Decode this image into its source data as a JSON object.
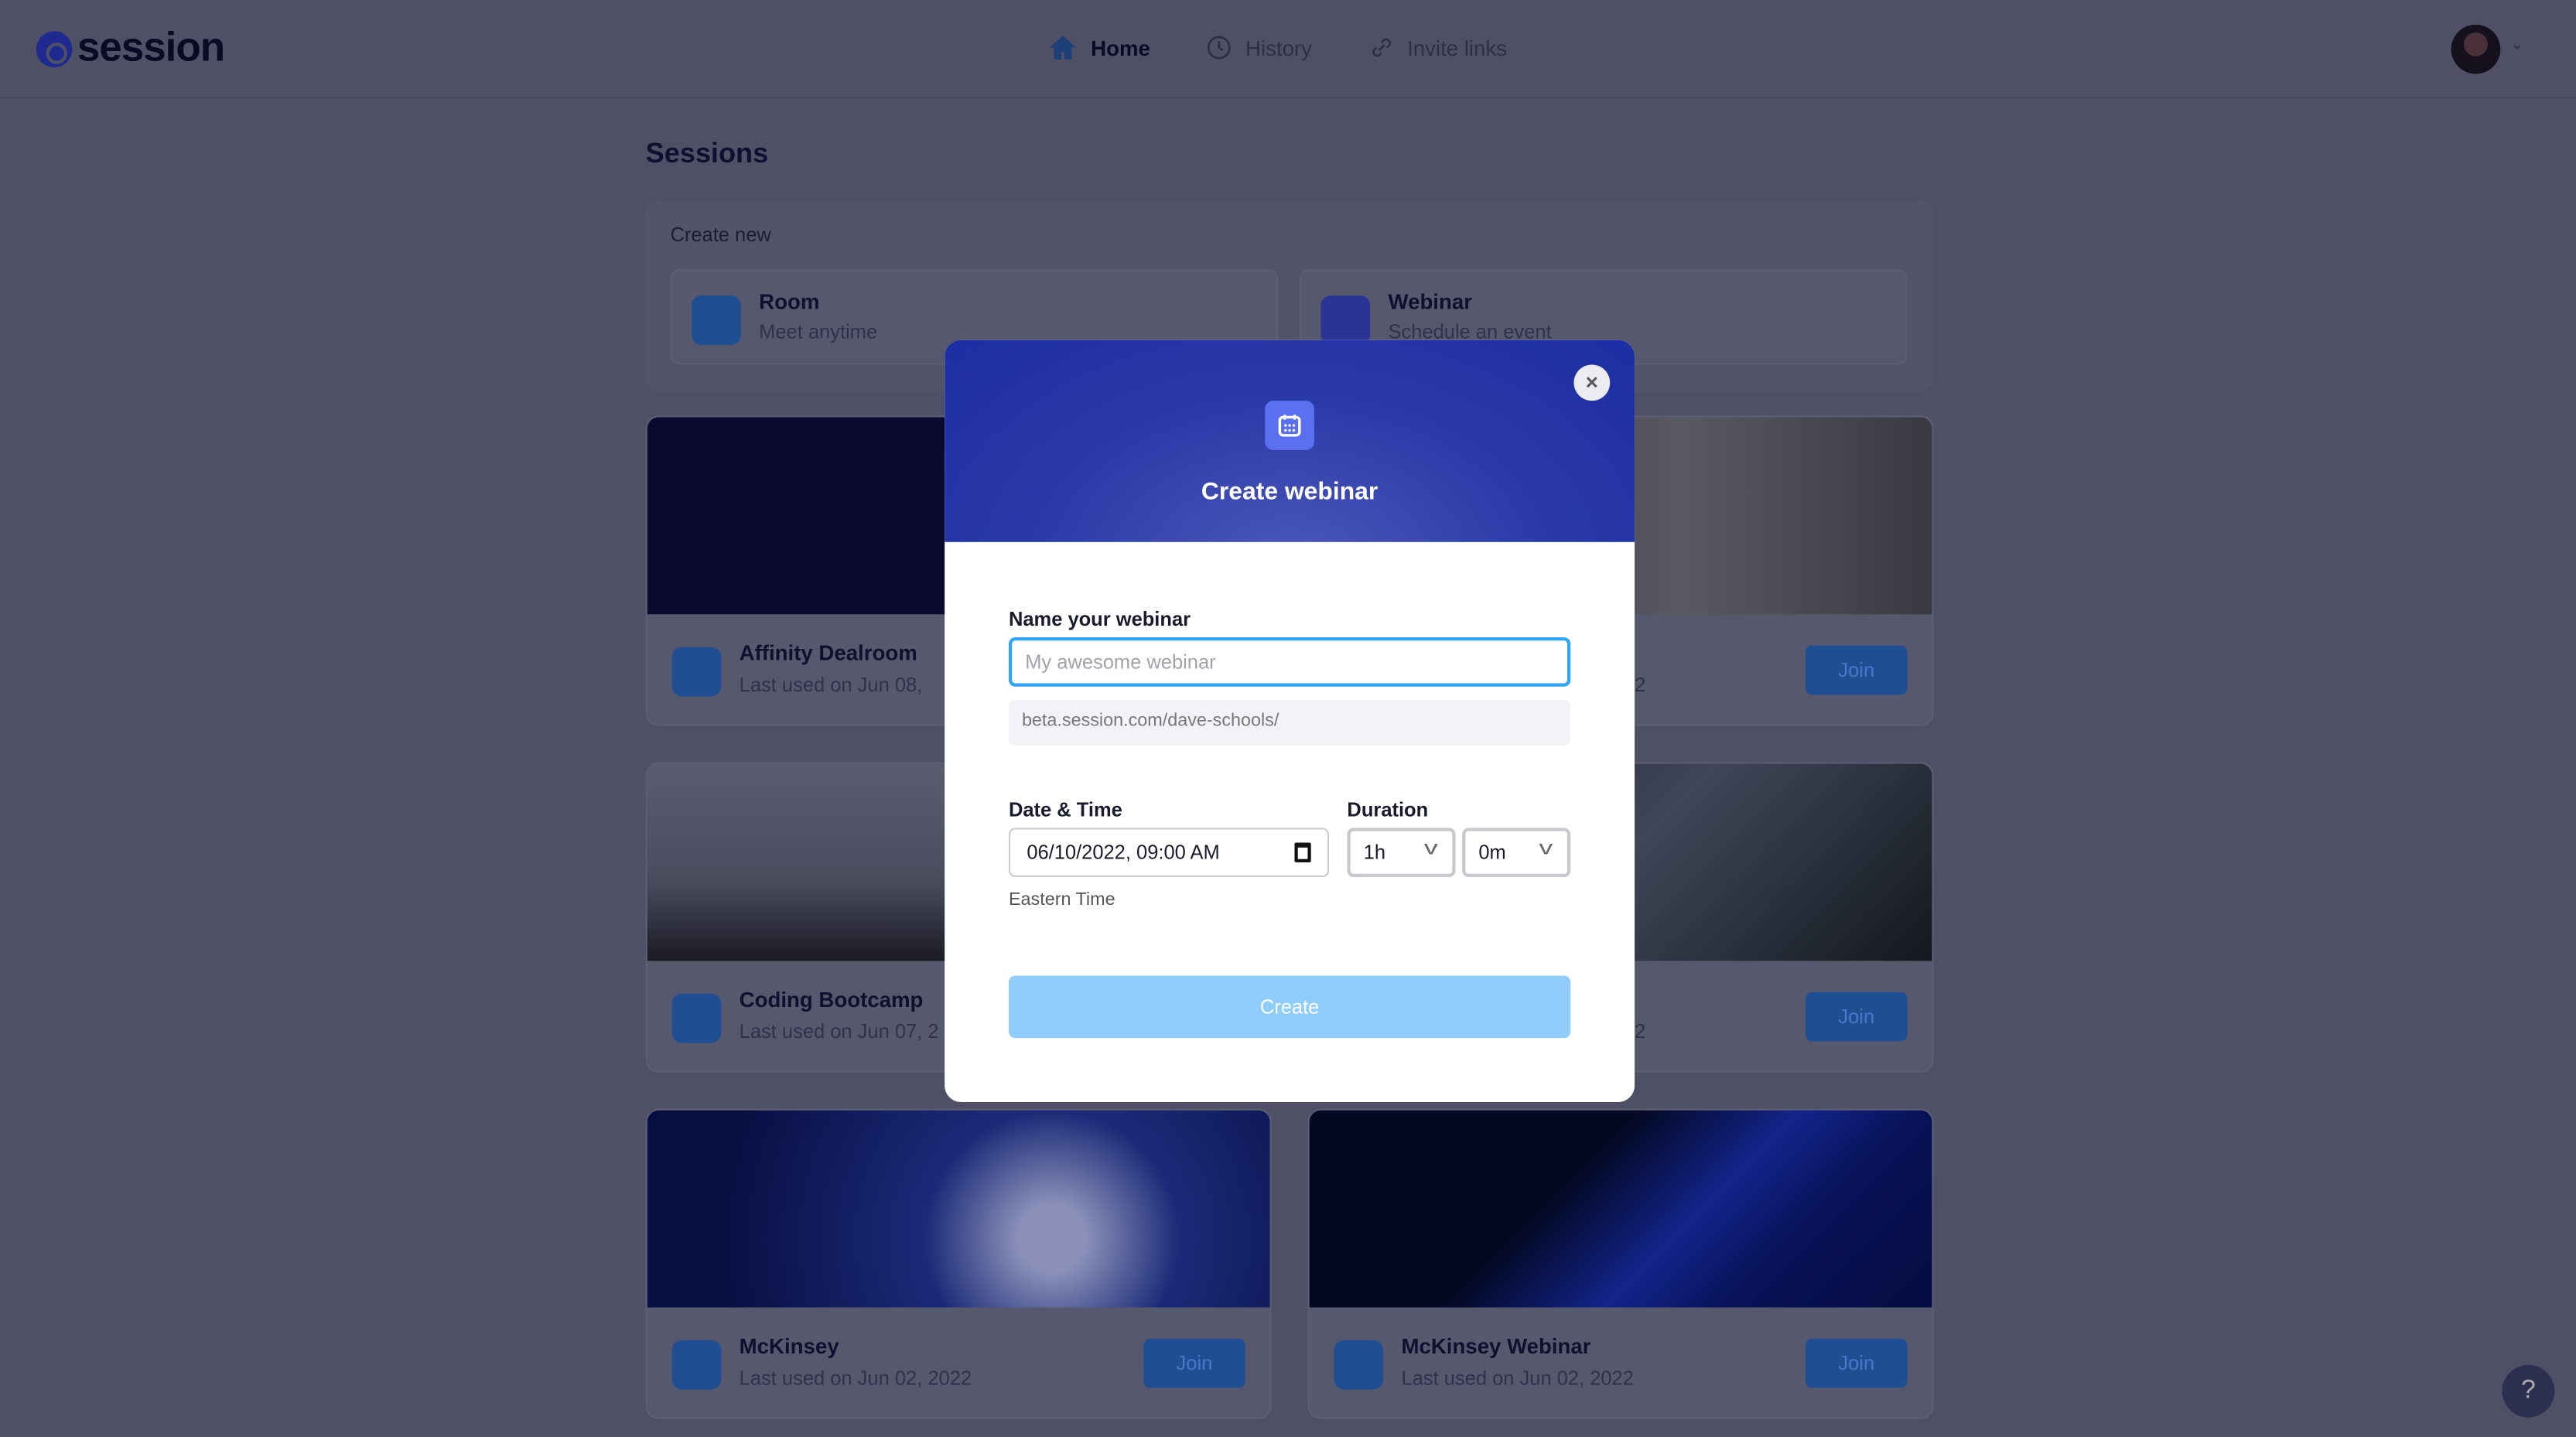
{
  "app": {
    "logo": "session"
  },
  "nav": [
    {
      "label": "Home",
      "icon": "home-icon"
    },
    {
      "label": "History",
      "icon": "clock-icon"
    },
    {
      "label": "Invite links",
      "icon": "link-icon"
    }
  ],
  "page": {
    "title": "Sessions",
    "create_new": "Create new",
    "create_options": [
      {
        "title": "Room",
        "subtitle": "Meet anytime"
      },
      {
        "title": "Webinar",
        "subtitle": "Schedule an event"
      }
    ],
    "sessions": [
      {
        "name": "Affinity Dealroom",
        "last_used": "Last used on Jun 08,"
      },
      {
        "name": "",
        "last_used": "2",
        "join": "Join"
      },
      {
        "name": "Coding Bootcamp",
        "last_used": "Last used on Jun 07, 2"
      },
      {
        "name": "",
        "last_used": "2",
        "join": "Join"
      },
      {
        "name": "McKinsey",
        "last_used": "Last used on Jun 02, 2022",
        "join": "Join"
      },
      {
        "name": "McKinsey Webinar",
        "last_used": "Last used on Jun 02, 2022",
        "join": "Join"
      }
    ]
  },
  "help": "?",
  "modal": {
    "title": "Create webinar",
    "close": "×",
    "name_label": "Name your webinar",
    "name_placeholder": "My awesome webinar",
    "name_value": "",
    "url_prefix": "beta.session.com/dave-schools/",
    "datetime_label": "Date & Time",
    "datetime_value": "06/10/2022, 09:00 AM",
    "duration_label": "Duration",
    "hours": "1h",
    "minutes": "0m",
    "timezone": "Eastern Time",
    "create": "Create"
  },
  "colors": {
    "accent": "#2d8cf0",
    "modal_header": "#1c2ea3",
    "focus": "#2fa6f5",
    "create_disabled": "#8fcdfb"
  }
}
